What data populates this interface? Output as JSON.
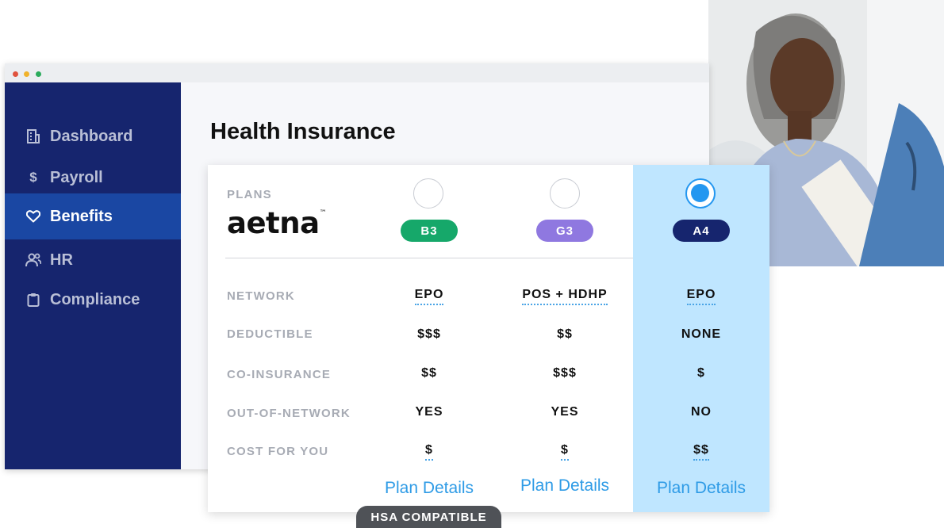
{
  "window": {
    "dots": [
      "#e0533f",
      "#f0b22c",
      "#2bab5c"
    ]
  },
  "sidebar": {
    "items": [
      {
        "label": "Dashboard",
        "icon": "building-icon",
        "active": false
      },
      {
        "label": "Payroll",
        "icon": "dollar-icon",
        "active": false
      },
      {
        "label": "Benefits",
        "icon": "heart-icon",
        "active": true
      },
      {
        "label": "HR",
        "icon": "people-icon",
        "active": false
      },
      {
        "label": "Compliance",
        "icon": "clipboard-icon",
        "active": false
      }
    ]
  },
  "page": {
    "title": "Health Insurance"
  },
  "plans": {
    "header_label": "PLANS",
    "carrier_logo": "aetna",
    "carrier_tm": "™",
    "columns": [
      {
        "code": "B3",
        "color": "#16a86a",
        "selected": false
      },
      {
        "code": "G3",
        "color": "#8f78e0",
        "selected": false
      },
      {
        "code": "A4",
        "color": "#16256e",
        "selected": true
      }
    ],
    "rows": [
      {
        "label": "NETWORK",
        "values": [
          "EPO",
          "POS + HDHP",
          "EPO"
        ]
      },
      {
        "label": "DEDUCTIBLE",
        "values": [
          "$$$",
          "$$",
          "NONE"
        ]
      },
      {
        "label": "CO-INSURANCE",
        "values": [
          "$$",
          "$$$",
          "$"
        ]
      },
      {
        "label": "OUT-OF-NETWORK",
        "values": [
          "YES",
          "YES",
          "NO"
        ]
      },
      {
        "label": "COST FOR YOU",
        "values": [
          "$",
          "$",
          "$$"
        ]
      }
    ],
    "details_link": "Plan Details",
    "badge": "HSA COMPATIBLE"
  },
  "colors": {
    "sidebar": "#16256e",
    "active": "#1a47a3",
    "accent": "#2497f0",
    "selected_column": "#bfe6ff"
  }
}
